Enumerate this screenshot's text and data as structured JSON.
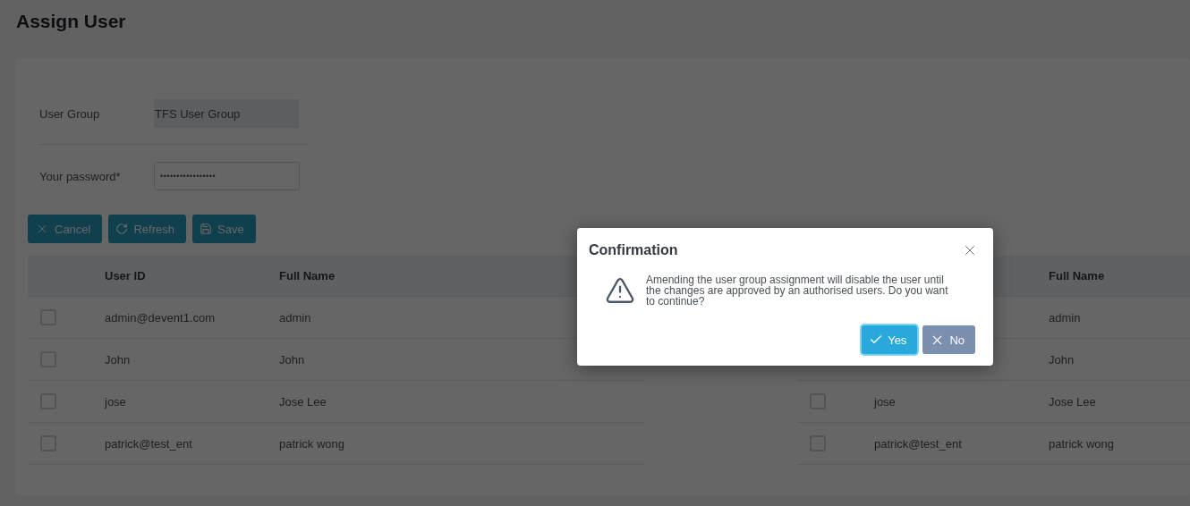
{
  "page": {
    "title": "Assign User"
  },
  "form": {
    "user_group": {
      "label": "User Group",
      "value": "TFS User Group"
    },
    "password": {
      "label": "Your password*",
      "value": "•••••••••••••••••"
    }
  },
  "toolbar": [
    {
      "kind": "cancel",
      "label": "Cancel"
    },
    {
      "kind": "refresh",
      "label": "Refresh"
    },
    {
      "kind": "save",
      "label": "Save"
    }
  ],
  "tables": [
    {
      "columns": {
        "user_id": "User ID",
        "full_name": "Full Name"
      },
      "rows": [
        {
          "checked": false,
          "user_id": "admin@devent1.com",
          "full_name": "admin"
        },
        {
          "checked": false,
          "user_id": "John",
          "full_name": "John"
        },
        {
          "checked": false,
          "user_id": "jose",
          "full_name": "Jose Lee"
        },
        {
          "checked": false,
          "user_id": "patrick@test_ent",
          "full_name": "patrick wong"
        }
      ]
    },
    {
      "columns": {
        "full_name": "Full Name"
      },
      "rows": [
        {
          "full_name": "admin"
        },
        {
          "full_name": "John"
        },
        {
          "checked": false,
          "user_id": "jose",
          "full_name": "Jose Lee"
        },
        {
          "checked": false,
          "user_id": "patrick@test_ent",
          "full_name": "patrick wong"
        }
      ]
    }
  ],
  "dialog": {
    "title": "Confirmation",
    "message": "Amending the user group assignment will disable the user until the changes are approved by an authorised users. Do you want to continue?",
    "buttons": [
      {
        "kind": "yes",
        "label": "Yes",
        "focused": true
      },
      {
        "kind": "no",
        "label": "No",
        "focused": false
      }
    ]
  }
}
